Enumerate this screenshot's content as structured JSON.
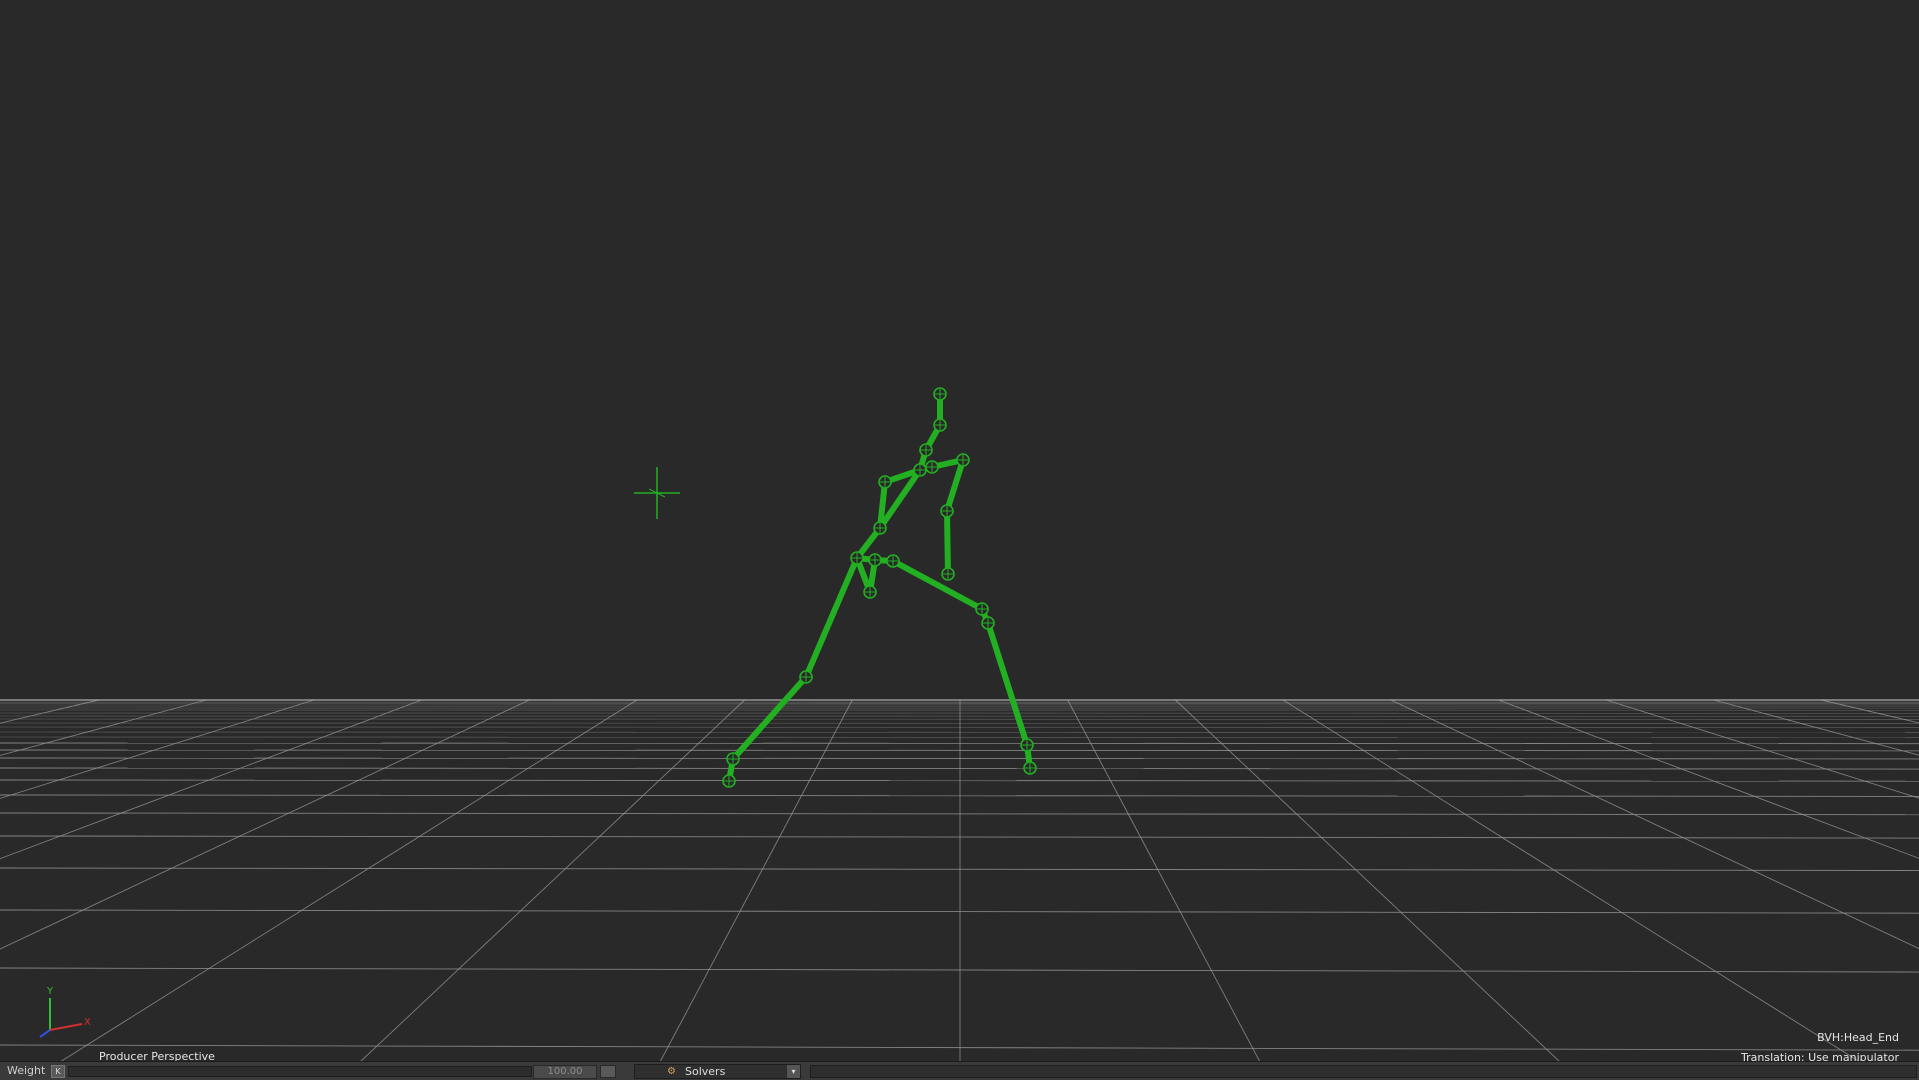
{
  "viewport": {
    "camera_name": "Producer Perspective",
    "selected_object": "BVH:Head_End",
    "manipulator_hint": "Translation: Use manipulator",
    "background_color": "#292929",
    "grid_color": "#9a9a9a",
    "skeleton_color": "#22b022",
    "axis_labels": {
      "y": "Y",
      "x": "X"
    }
  },
  "bottom_bar": {
    "weight_label": "Weight",
    "weight_reset": "K",
    "weight_value": "100.00",
    "solvers_label": "Solvers",
    "solvers_icon": "solver-icon",
    "dropdown_arrow": "▾"
  }
}
